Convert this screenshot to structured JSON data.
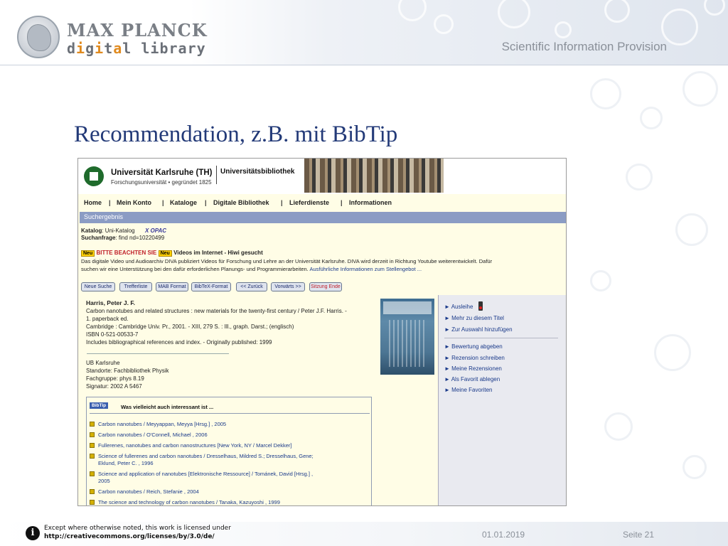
{
  "header": {
    "brand_line1": "MAX PLANCK",
    "brand_line2": "digital library",
    "tagline": "Scientific Information Provision"
  },
  "slide_title": "Recommendation, z.B. mit BibTip",
  "screenshot": {
    "banner": {
      "university": "Universität Karlsruhe (TH)",
      "subtitle": "Forschungsuniversität • gegründet 1825",
      "library": "Universitätsbibliothek"
    },
    "nav": [
      {
        "label": "Home"
      },
      {
        "label": "Mein Konto"
      },
      {
        "label": "Kataloge"
      },
      {
        "label": "Digitale Bibliothek"
      },
      {
        "label": "Lieferdienste"
      },
      {
        "label": "Informationen"
      }
    ],
    "result_bar": "Suchergebnis",
    "katalog_label": "Katalog",
    "katalog_value": ": Uni-Katalog",
    "xopac": "X OPAC",
    "suchanfrage_label": "Suchanfrage",
    "suchanfrage_value": ": find nd=10220499",
    "notice": {
      "badge": "Neu",
      "warning": "BITTE BEACHTEN SIE",
      "badge2": "Neu",
      "headline": "Videos im Internet - Hiwi gesucht",
      "text1": "Das digitale Video und Audioarchiv DIVA publiziert Videos für Forschung und Lehre an der Universität Karlsruhe. DIVA wird derzeit in Richtung Youtube weiterentwickelt. Dafür",
      "text2": "suchen wir eine Unterstützung bei den dafür erforderlichen Planungs- und Programmierarbeiten.",
      "link": "Ausführliche Informationen zum Stellengebot ..."
    },
    "buttons": [
      {
        "label": "Neue Suche"
      },
      {
        "label": "Trefferliste"
      },
      {
        "label": "MAB Format"
      },
      {
        "label": "BibTeX-Format"
      },
      {
        "label": "<< Zurück"
      },
      {
        "label": "Vorwärts >>"
      },
      {
        "label": "Sitzung Ende"
      }
    ],
    "record": {
      "author": "Harris, Peter J. F.",
      "lines": [
        "Carbon nanotubes and related structures : new materials for the twenty-first century / Peter J.F. Harris. -",
        "1. paperback ed.",
        "Cambridge : Cambridge Univ. Pr., 2001. - XIII, 279 S. : Ill., graph. Darst.; (englisch)",
        "ISBN 0-521-00533-7",
        "Includes bibliographical references and index. - Originally published: 1999"
      ],
      "holdings": [
        "UB Karlsruhe",
        "Standorte: Fachbibliothek Physik",
        "Fachgruppe: phys 8.19",
        "Signatur: 2002 A 5467"
      ]
    },
    "side_links": [
      {
        "label": "► Ausleihe"
      },
      {
        "label": "► Mehr zu diesem Titel"
      },
      {
        "label": "► Zur Auswahl hinzufügen"
      },
      {
        "label": "► Bewertung abgeben"
      },
      {
        "label": "► Rezension schreiben"
      },
      {
        "label": "► Meine Rezensionen"
      },
      {
        "label": "► Als Favorit ablegen"
      },
      {
        "label": "► Meine Favoriten"
      }
    ],
    "bibtip": {
      "badge": "BibTip",
      "heading": "Was vielleicht auch interessant ist ...",
      "items": [
        "Carbon nanotubes / Meyyappan, Meyya [Hrsg.] , 2005",
        "Carbon nanotubes / O'Connell, Michael , 2006",
        "Fullerenes, nanotubes and carbon nanostructures [New York, NY / Marcel Dekker]",
        "Science of fullerenes and carbon nanotubes / Dresselhaus, Mildred S.; Dresselhaus, Gene;",
        "Eklund, Peter C. , 1996",
        "Science and application of nanotubes [Elektronische Ressource] / Tománek, David [Hrsg.] ,",
        "2005",
        "Carbon nanotubes / Reich, Stefanie , 2004",
        "The science and technology of carbon nanotubes / Tanaka, Kazuyoshi , 1999"
      ]
    }
  },
  "footer": {
    "license_line1": "Except where otherwise noted, this work is licensed under",
    "license_line2": "http://creativecommons.org/licenses/by/3.0/de/",
    "date": "01.01.2019",
    "page": "Seite 21"
  }
}
